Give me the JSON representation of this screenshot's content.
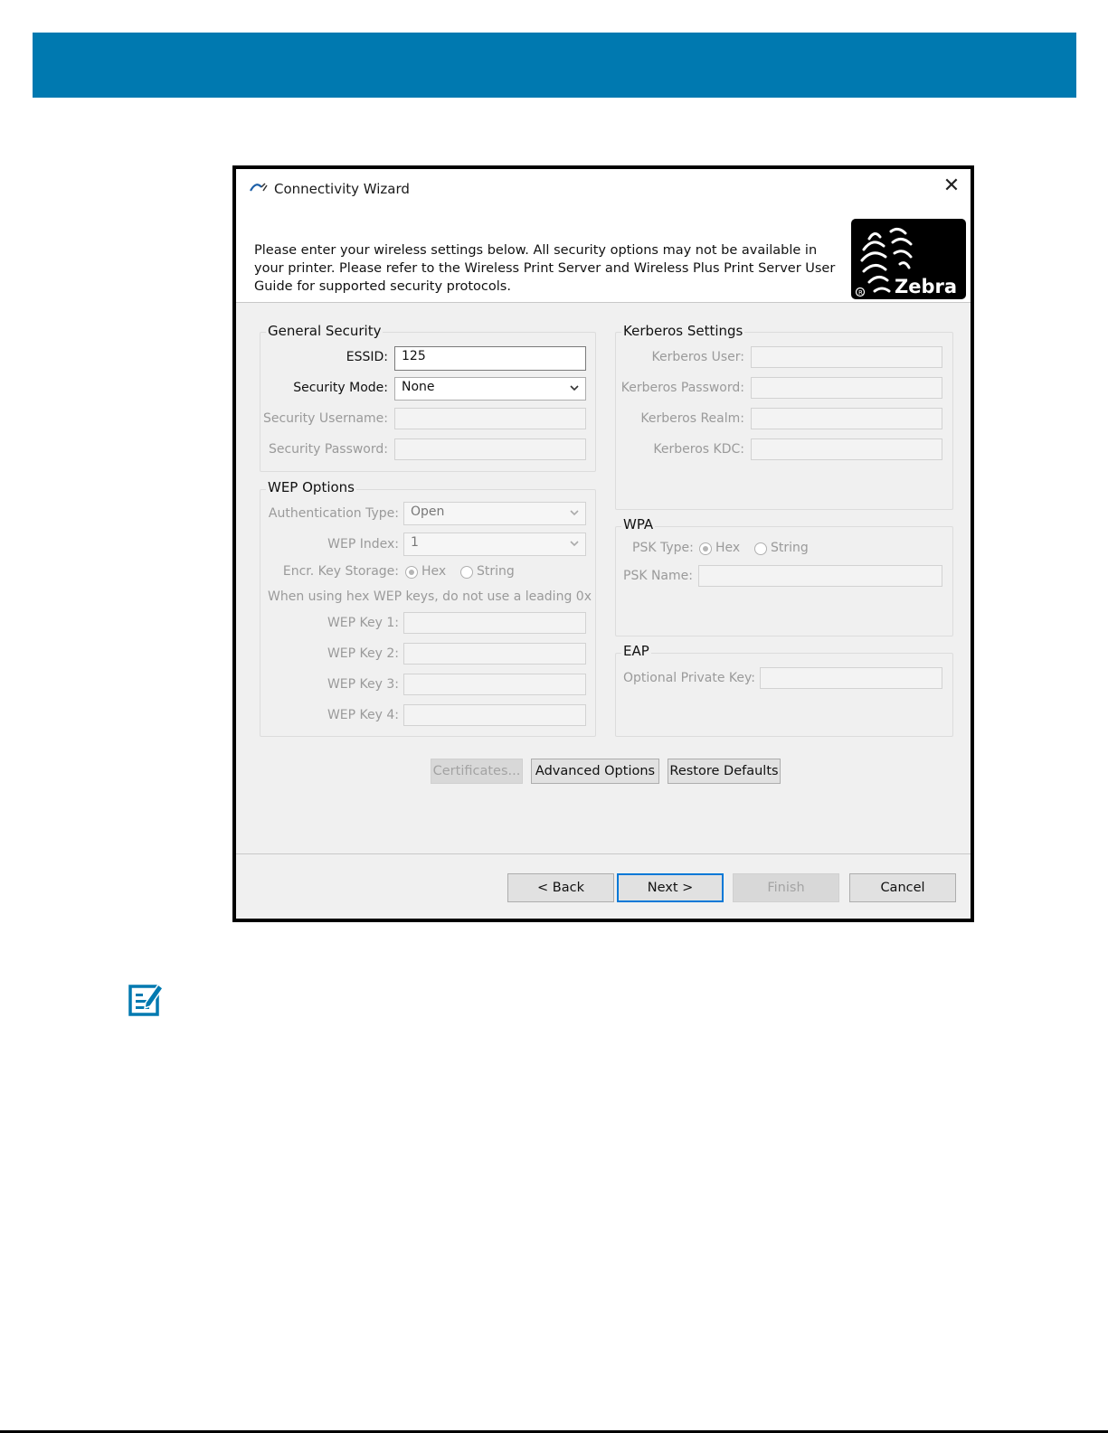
{
  "colors": {
    "banner": "#0079b0",
    "default_button_border": "#0078d7"
  },
  "icons": {
    "title_icon": "connectivity-wizard-icon",
    "close_icon": "close-icon",
    "note_icon": "note-pencil-icon",
    "logo": "zebra-logo"
  },
  "dialog": {
    "title": "Connectivity Wizard",
    "close": "✕",
    "intro": "Please enter your wireless settings below.  All security options may not be available in your printer. Please refer to the Wireless Print Server and Wireless Plus Print Server User Guide for supported security protocols.",
    "logo_text": "Zebra"
  },
  "general": {
    "title": "General Security",
    "essid_label": "ESSID:",
    "essid_value": "125",
    "mode_label": "Security Mode:",
    "mode_value": "None",
    "user_label": "Security Username:",
    "pass_label": "Security Password:"
  },
  "wep": {
    "title": "WEP Options",
    "auth_label": "Authentication Type:",
    "auth_value": "Open",
    "index_label": "WEP Index:",
    "index_value": "1",
    "storage_label": "Encr. Key Storage:",
    "hex": "Hex",
    "string": "String",
    "hint": "When using hex WEP keys, do not use a leading 0x",
    "key1": "WEP Key 1:",
    "key2": "WEP Key 2:",
    "key3": "WEP Key 3:",
    "key4": "WEP Key 4:"
  },
  "kerberos": {
    "title": "Kerberos Settings",
    "user": "Kerberos User:",
    "password": "Kerberos Password:",
    "realm": "Kerberos Realm:",
    "kdc": "Kerberos KDC:"
  },
  "wpa": {
    "title": "WPA",
    "psk_type": "PSK Type:",
    "hex": "Hex",
    "string": "String",
    "psk_name": "PSK Name:"
  },
  "eap": {
    "title": "EAP",
    "key": "Optional Private Key:"
  },
  "buttons": {
    "certificates": "Certificates...",
    "advanced": "Advanced Options",
    "restore": "Restore Defaults",
    "back": "< Back",
    "next": "Next >",
    "finish": "Finish",
    "cancel": "Cancel"
  }
}
